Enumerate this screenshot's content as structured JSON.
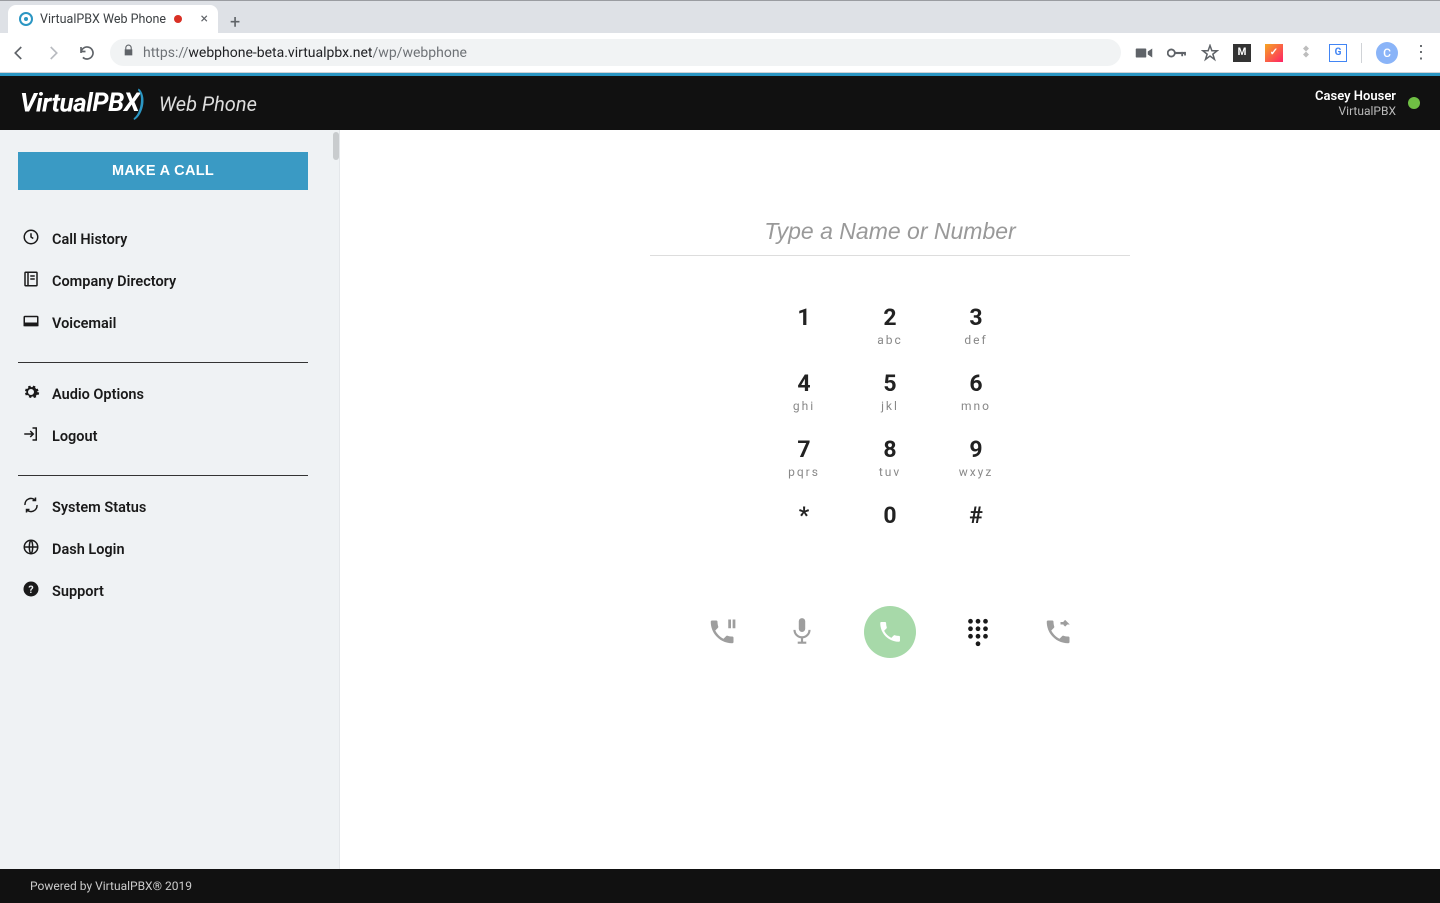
{
  "browser": {
    "tab_title": "VirtualPBX Web Phone",
    "url_scheme": "https://",
    "url_host": "webphone-beta.virtualpbx.net",
    "url_path": "/wp/webphone"
  },
  "header": {
    "brand_primary": "Virtual",
    "brand_secondary": "PBX",
    "brand_sub": "Web Phone",
    "user_name": "Casey Houser",
    "user_org": "VirtualPBX"
  },
  "sidebar": {
    "make_call": "MAKE A CALL",
    "items_a": [
      {
        "label": "Call History",
        "icon": "clock"
      },
      {
        "label": "Company Directory",
        "icon": "book"
      },
      {
        "label": "Voicemail",
        "icon": "voicemail"
      }
    ],
    "items_b": [
      {
        "label": "Audio Options",
        "icon": "gear"
      },
      {
        "label": "Logout",
        "icon": "logout"
      }
    ],
    "items_c": [
      {
        "label": "System Status",
        "icon": "sync"
      },
      {
        "label": "Dash Login",
        "icon": "globe"
      },
      {
        "label": "Support",
        "icon": "help"
      }
    ]
  },
  "dialer": {
    "placeholder": "Type a Name or Number",
    "keys": [
      {
        "digit": "1",
        "letters": ""
      },
      {
        "digit": "2",
        "letters": "abc"
      },
      {
        "digit": "3",
        "letters": "def"
      },
      {
        "digit": "4",
        "letters": "ghi"
      },
      {
        "digit": "5",
        "letters": "jkl"
      },
      {
        "digit": "6",
        "letters": "mno"
      },
      {
        "digit": "7",
        "letters": "pqrs"
      },
      {
        "digit": "8",
        "letters": "tuv"
      },
      {
        "digit": "9",
        "letters": "wxyz"
      },
      {
        "digit": "*",
        "letters": ""
      },
      {
        "digit": "0",
        "letters": ""
      },
      {
        "digit": "#",
        "letters": ""
      }
    ]
  },
  "footer": {
    "text": "Powered by VirtualPBX® 2019"
  }
}
